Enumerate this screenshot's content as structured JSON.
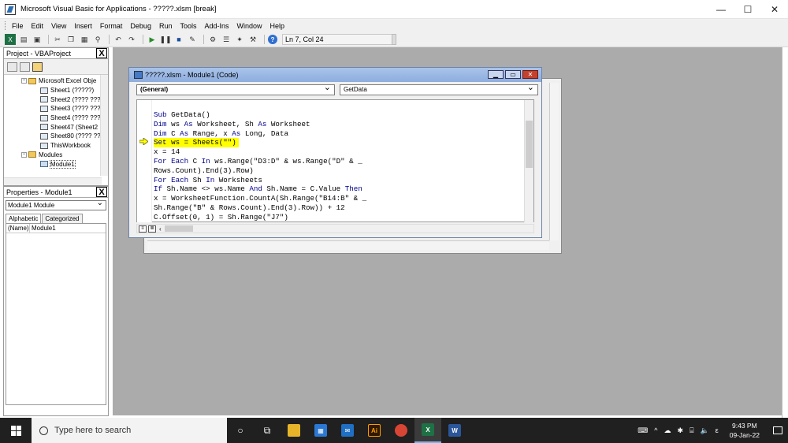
{
  "window": {
    "title": "Microsoft Visual Basic for Applications - ?????.xlsm [break]",
    "minimize": "—",
    "maximize": "☐",
    "close": "✕"
  },
  "menu": [
    "File",
    "Edit",
    "View",
    "Insert",
    "Format",
    "Debug",
    "Run",
    "Tools",
    "Add-Ins",
    "Window",
    "Help"
  ],
  "toolbar": {
    "status": "Ln 7, Col 24"
  },
  "project_panel": {
    "title": "Project - VBAProject",
    "close": "X",
    "tree": [
      {
        "label": "Microsoft Excel Obje",
        "type": "folder",
        "indent": 1
      },
      {
        "label": "Sheet1 (?????)",
        "type": "sheet",
        "indent": 2
      },
      {
        "label": "Sheet2 (???? ???",
        "type": "sheet",
        "indent": 2
      },
      {
        "label": "Sheet3 (???? ???",
        "type": "sheet",
        "indent": 2
      },
      {
        "label": "Sheet4 (???? ???",
        "type": "sheet",
        "indent": 2
      },
      {
        "label": "Sheet47 (Sheet2",
        "type": "sheet",
        "indent": 2
      },
      {
        "label": "Sheet80 (???? ??",
        "type": "sheet",
        "indent": 2
      },
      {
        "label": "ThisWorkbook",
        "type": "sheet",
        "indent": 2
      },
      {
        "label": "Modules",
        "type": "folder",
        "indent": 1
      },
      {
        "label": "Module1",
        "type": "mod",
        "indent": 2,
        "selected": true
      }
    ]
  },
  "properties_panel": {
    "title": "Properties - Module1",
    "close": "X",
    "object": "Module1 Module",
    "tabs": [
      "Alphabetic",
      "Categorized"
    ],
    "rows": [
      {
        "name": "(Name)",
        "value": "Module1"
      }
    ]
  },
  "code_window": {
    "title": "?????.xlsm - Module1 (Code)",
    "object_combo": "(General)",
    "proc_combo": "GetData",
    "lines": [
      {
        "text": "Sub GetData()",
        "kw": [
          "Sub"
        ]
      },
      {
        "text": "Dim ws As Worksheet, Sh As Worksheet",
        "kw": [
          "Dim",
          "As"
        ]
      },
      {
        "text": "Dim C As Range, x As Long, Data",
        "kw": [
          "Dim",
          "As"
        ]
      },
      {
        "text": "Set ws = Sheets(\"\")",
        "kw": [
          "Set"
        ],
        "highlight": true
      },
      {
        "text": "x = 14",
        "kw": []
      },
      {
        "text": "For Each C In ws.Range(\"D3:D\" & ws.Range(\"D\" & _",
        "kw": [
          "For",
          "Each",
          "In"
        ]
      },
      {
        "text": "Rows.Count).End(3).Row)",
        "kw": []
      },
      {
        "text": "For Each Sh In Worksheets",
        "kw": [
          "For",
          "Each",
          "In"
        ]
      },
      {
        "text": "If Sh.Name <> ws.Name And Sh.Name = C.Value Then",
        "kw": [
          "If",
          "And",
          "Then"
        ]
      },
      {
        "text": "x = WorksheetFunction.CountA(Sh.Range(\"B14:B\" & _",
        "kw": []
      },
      {
        "text": "Sh.Range(\"B\" & Rows.Count).End(3).Row)) + 12",
        "kw": []
      },
      {
        "text": "C.Offset(0, 1) = Sh.Range(\"J7\")",
        "kw": []
      }
    ]
  },
  "taskbar": {
    "search_placeholder": "Type here to search",
    "time": "9:43 PM",
    "date": "09-Jan-22",
    "lang": "ε"
  },
  "colors": {
    "keyword": "#00008b",
    "highlight": "#ffff00",
    "mdi_bg": "#ababab"
  }
}
